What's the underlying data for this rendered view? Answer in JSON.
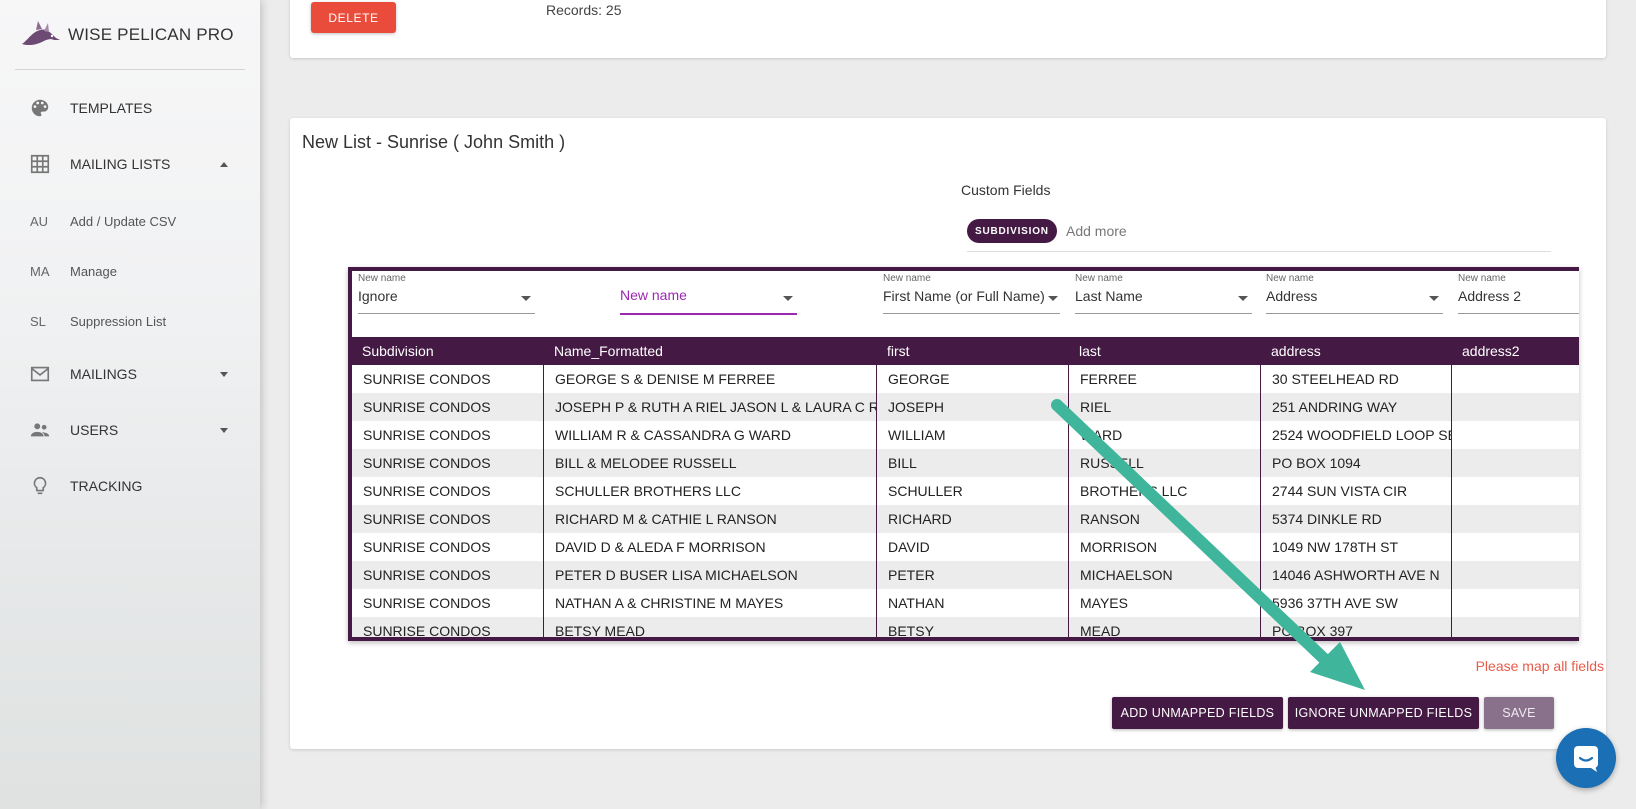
{
  "app": {
    "name": "WISE PELICAN PRO"
  },
  "sidebar": {
    "items": [
      {
        "label": "TEMPLATES",
        "icon": "palette-icon"
      },
      {
        "label": "MAILING LISTS",
        "icon": "grid-icon"
      },
      {
        "label": "MAILINGS",
        "icon": "mail-icon"
      },
      {
        "label": "USERS",
        "icon": "people-icon"
      },
      {
        "label": "TRACKING",
        "icon": "lightbulb-icon"
      }
    ],
    "subitems": [
      {
        "abbr": "AU",
        "label": "Add / Update CSV"
      },
      {
        "abbr": "MA",
        "label": "Manage"
      },
      {
        "abbr": "SL",
        "label": "Suppression List"
      }
    ]
  },
  "top_card": {
    "delete_label": "DELETE",
    "records": "Records: 25"
  },
  "main": {
    "title": "New List - Sunrise ( John Smith )",
    "custom_fields_title": "Custom Fields",
    "chip": "SUBDIVISION",
    "add_more": "Add more",
    "mappings": [
      {
        "small": "New name",
        "value": "Ignore"
      },
      {
        "small": "",
        "value": "New name"
      },
      {
        "small": "New name",
        "value": "First Name (or Full Name)"
      },
      {
        "small": "New name",
        "value": "Last Name"
      },
      {
        "small": "New name",
        "value": "Address"
      },
      {
        "small": "New name",
        "value": "Address 2"
      }
    ],
    "columns": [
      "Subdivision",
      "Name_Formatted",
      "first",
      "last",
      "address",
      "address2"
    ],
    "rows": [
      [
        "SUNRISE CONDOS",
        "GEORGE S & DENISE M FERREE",
        "GEORGE",
        "FERREE",
        "30 STEELHEAD RD",
        ""
      ],
      [
        "SUNRISE CONDOS",
        "JOSEPH P & RUTH A RIEL JASON L & LAURA C RIEL",
        "JOSEPH",
        "RIEL",
        "251 ANDRING WAY",
        ""
      ],
      [
        "SUNRISE CONDOS",
        "WILLIAM R & CASSANDRA G WARD",
        "WILLIAM",
        "WARD",
        "2524 WOODFIELD LOOP SE",
        ""
      ],
      [
        "SUNRISE CONDOS",
        "BILL & MELODEE RUSSELL",
        "BILL",
        "RUSSELL",
        "PO BOX 1094",
        ""
      ],
      [
        "SUNRISE CONDOS",
        "SCHULLER BROTHERS LLC",
        "SCHULLER",
        "BROTHERS LLC",
        "2744 SUN VISTA CIR",
        ""
      ],
      [
        "SUNRISE CONDOS",
        "RICHARD M & CATHIE L RANSON",
        "RICHARD",
        "RANSON",
        "5374 DINKLE RD",
        ""
      ],
      [
        "SUNRISE CONDOS",
        "DAVID D & ALEDA F MORRISON",
        "DAVID",
        "MORRISON",
        "1049 NW 178TH ST",
        ""
      ],
      [
        "SUNRISE CONDOS",
        "PETER D BUSER LISA MICHAELSON",
        "PETER",
        "MICHAELSON",
        "14046 ASHWORTH AVE N",
        ""
      ],
      [
        "SUNRISE CONDOS",
        "NATHAN A & CHRISTINE M MAYES",
        "NATHAN",
        "MAYES",
        "5936 37TH AVE SW",
        ""
      ],
      [
        "SUNRISE CONDOS",
        "BETSY MEAD",
        "BETSY",
        "MEAD",
        "PO BOX 397",
        ""
      ]
    ],
    "warning": "Please map all fields",
    "buttons": {
      "add_unmapped": "ADD UNMAPPED FIELDS",
      "ignore_unmapped": "IGNORE UNMAPPED FIELDS",
      "save": "SAVE"
    }
  },
  "colors": {
    "primary": "#441a44",
    "delete": "#ea4c3b",
    "warning": "#e85c4a",
    "active": "#9c27b0",
    "arrow": "#3fb59b",
    "chat": "#1b6fb5"
  }
}
